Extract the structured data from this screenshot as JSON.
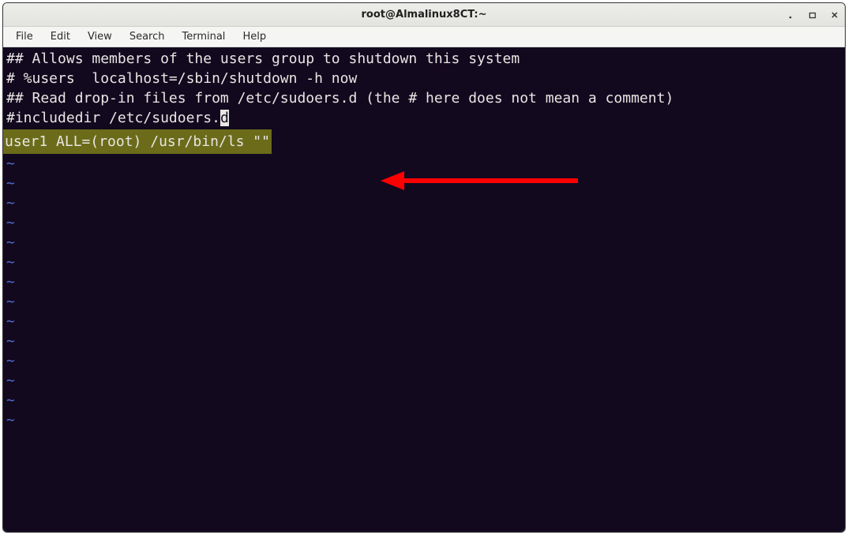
{
  "window": {
    "title": "root@Almalinux8CT:~"
  },
  "menu": {
    "file": "File",
    "edit": "Edit",
    "view": "View",
    "search": "Search",
    "terminal": "Terminal",
    "help": "Help"
  },
  "terminal": {
    "lines": {
      "l1": "## Allows members of the users group to shutdown this system",
      "l2": "# %users  localhost=/sbin/shutdown -h now",
      "l3": "",
      "l4": "## Read drop-in files from /etc/sudoers.d (the # here does not mean a comment)",
      "l5a": "#includedir /etc/sudoers.",
      "l5b": "d",
      "l6": "",
      "hl": "user1   ALL=(root)     /usr/bin/ls \"\" "
    },
    "tilde": "~"
  },
  "colors": {
    "terminal_bg": "#13091f",
    "terminal_fg": "#e8e6e3",
    "highlight_bg": "#6b6b1a",
    "tilde_fg": "#4d6fd8",
    "arrow": "#ff0000"
  }
}
